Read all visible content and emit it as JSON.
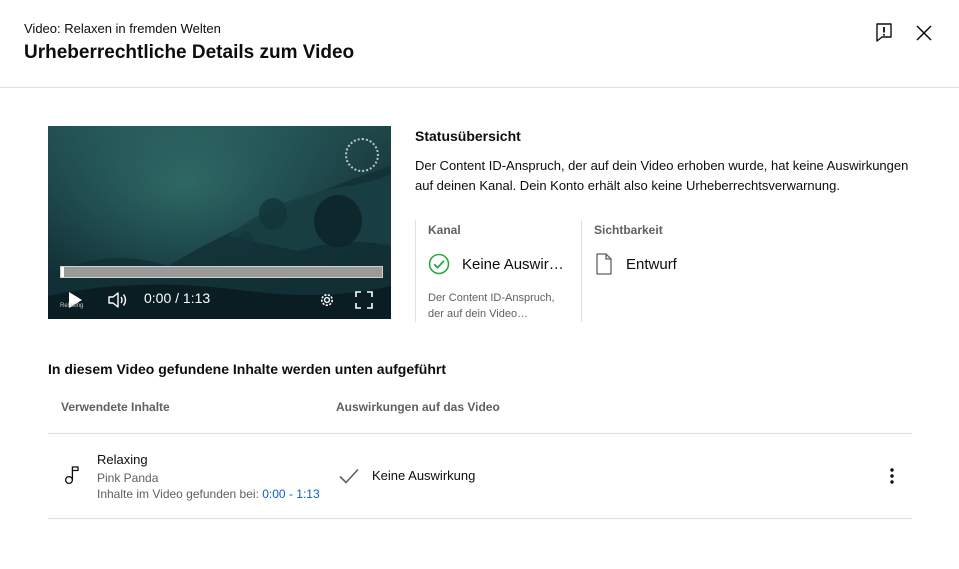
{
  "header": {
    "subtitle": "Video: Relaxen in fremden Welten",
    "title": "Urheberrechtliche Details zum Video",
    "feedback_icon": "feedback-icon",
    "close_icon": "close-icon"
  },
  "player": {
    "time": "0:00 / 1:13",
    "watermark": "Relaxing",
    "progress": 0.0,
    "icons": [
      "play-icon",
      "volume-icon",
      "settings-gear-icon",
      "fullscreen-icon"
    ]
  },
  "status": {
    "heading": "Statusübersicht",
    "description": "Der Content ID-Anspruch, der auf dein Video erhoben wurde, hat keine Auswirkungen auf deinen Kanal. Dein Konto erhält also keine Urheberrechtsverwarnung.",
    "kanal": {
      "label": "Kanal",
      "value": "Keine Auswirkungen",
      "note": "Der Content ID-Anspruch, der auf dein Video…",
      "icon": "check-circle-icon",
      "accent": "#2ba640"
    },
    "sichtbarkeit": {
      "label": "Sichtbarkeit",
      "value": "Entwurf",
      "icon": "draft-document-icon"
    }
  },
  "content": {
    "section_title": "In diesem Video gefundene Inhalte werden unten aufgeführt",
    "columns": [
      "Verwendete Inhalte",
      "Auswirkungen auf das Video"
    ],
    "rows": [
      {
        "icon": "music-note-icon",
        "title": "Relaxing",
        "artist": "Pink Panda",
        "found_label": "Inhalte im Video gefunden bei:",
        "found_range": "0:00 - 1:13",
        "effect_icon": "check-icon",
        "effect": "Keine Auswirkung",
        "menu_icon": "more-vert-icon"
      }
    ]
  },
  "colors": {
    "link": "#065fd4",
    "secondary_text": "#606060",
    "divider": "#e0e0e0"
  }
}
